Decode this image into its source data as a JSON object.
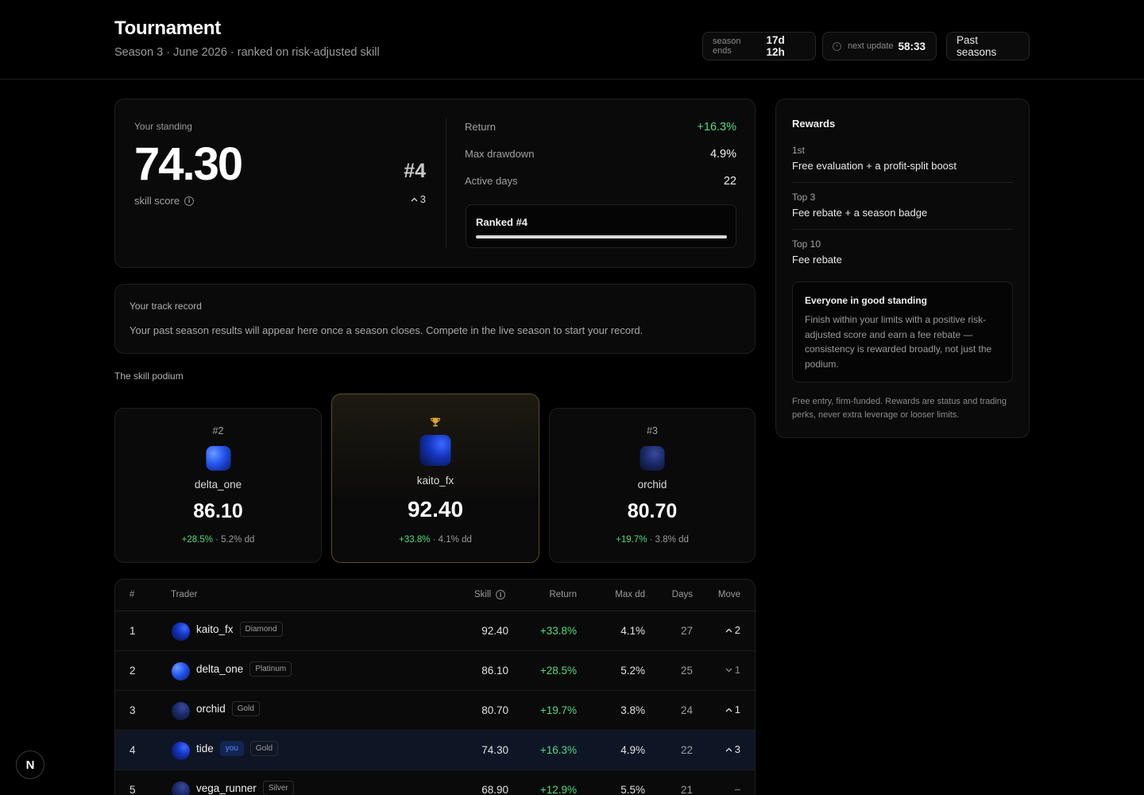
{
  "header": {
    "title": "Tournament",
    "subtitle": "Season 3 · June 2026 · ranked on risk-adjusted skill",
    "season_ends_label": "season ends",
    "season_ends_value": "17d 12h",
    "next_update_label": "next update",
    "next_update_value": "58:33",
    "past_seasons": "Past seasons"
  },
  "standing": {
    "label": "Your standing",
    "score": "74.30",
    "score_label": "skill score",
    "rank": "#4",
    "move": "3",
    "metrics": [
      {
        "label": "Return",
        "value": "+16.3%"
      },
      {
        "label": "Max drawdown",
        "value": "4.9%"
      },
      {
        "label": "Active days",
        "value": "22"
      }
    ],
    "ranked_label": "Ranked #4",
    "progress_fraction": 1.0
  },
  "track": {
    "title": "Your track record",
    "description": "Your past season results will appear here once a season closes. Compete in the live season to start your record."
  },
  "podium": {
    "title": "The skill podium",
    "first": {
      "name": "kaito_fx",
      "score": "92.40",
      "return": "+33.8%",
      "dd": " · 4.1% dd"
    },
    "second": {
      "rank": "#2",
      "name": "delta_one",
      "score": "86.10",
      "return": "+28.5%",
      "dd": " · 5.2% dd"
    },
    "third": {
      "rank": "#3",
      "name": "orchid",
      "score": "80.70",
      "return": "+19.7%",
      "dd": " · 3.8% dd"
    }
  },
  "table": {
    "headers": {
      "rank": "#",
      "trader": "Trader",
      "skill": "Skill",
      "return": "Return",
      "max_dd": "Max dd",
      "days": "Days",
      "move": "Move"
    },
    "you_label": "you",
    "rows": [
      {
        "rank": "1",
        "name": "kaito_fx",
        "tier": "Diamond",
        "skill": "92.40",
        "return": "+33.8%",
        "dd": "4.1%",
        "days": "27",
        "move": "2",
        "dir": "up"
      },
      {
        "rank": "2",
        "name": "delta_one",
        "tier": "Platinum",
        "skill": "86.10",
        "return": "+28.5%",
        "dd": "5.2%",
        "days": "25",
        "move": "1",
        "dir": "down"
      },
      {
        "rank": "3",
        "name": "orchid",
        "tier": "Gold",
        "skill": "80.70",
        "return": "+19.7%",
        "dd": "3.8%",
        "days": "24",
        "move": "1",
        "dir": "up"
      },
      {
        "rank": "4",
        "name": "tide",
        "tier": "Gold",
        "skill": "74.30",
        "return": "+16.3%",
        "dd": "4.9%",
        "days": "22",
        "move": "3",
        "dir": "up"
      },
      {
        "rank": "5",
        "name": "vega_runner",
        "tier": "Silver",
        "skill": "68.90",
        "return": "+12.9%",
        "dd": "5.5%",
        "days": "21",
        "move": "–",
        "dir": "none"
      }
    ]
  },
  "rewards": {
    "title": "Rewards",
    "items": [
      {
        "tier": "1st",
        "desc": "Free evaluation + a profit-split boost"
      },
      {
        "tier": "Top 3",
        "desc": "Fee rebate + a season badge"
      },
      {
        "tier": "Top 10",
        "desc": "Fee rebate"
      }
    ],
    "good_title": "Everyone in good standing",
    "good_desc": "Finish within your limits with a positive risk-adjusted score and earn a fee rebate — consistency is rewarded broadly, not just the podium.",
    "footer": "Free entry, firm-funded. Rewards are status and trading perks, never extra leverage or looser limits."
  },
  "fab": {
    "letter": "N"
  }
}
